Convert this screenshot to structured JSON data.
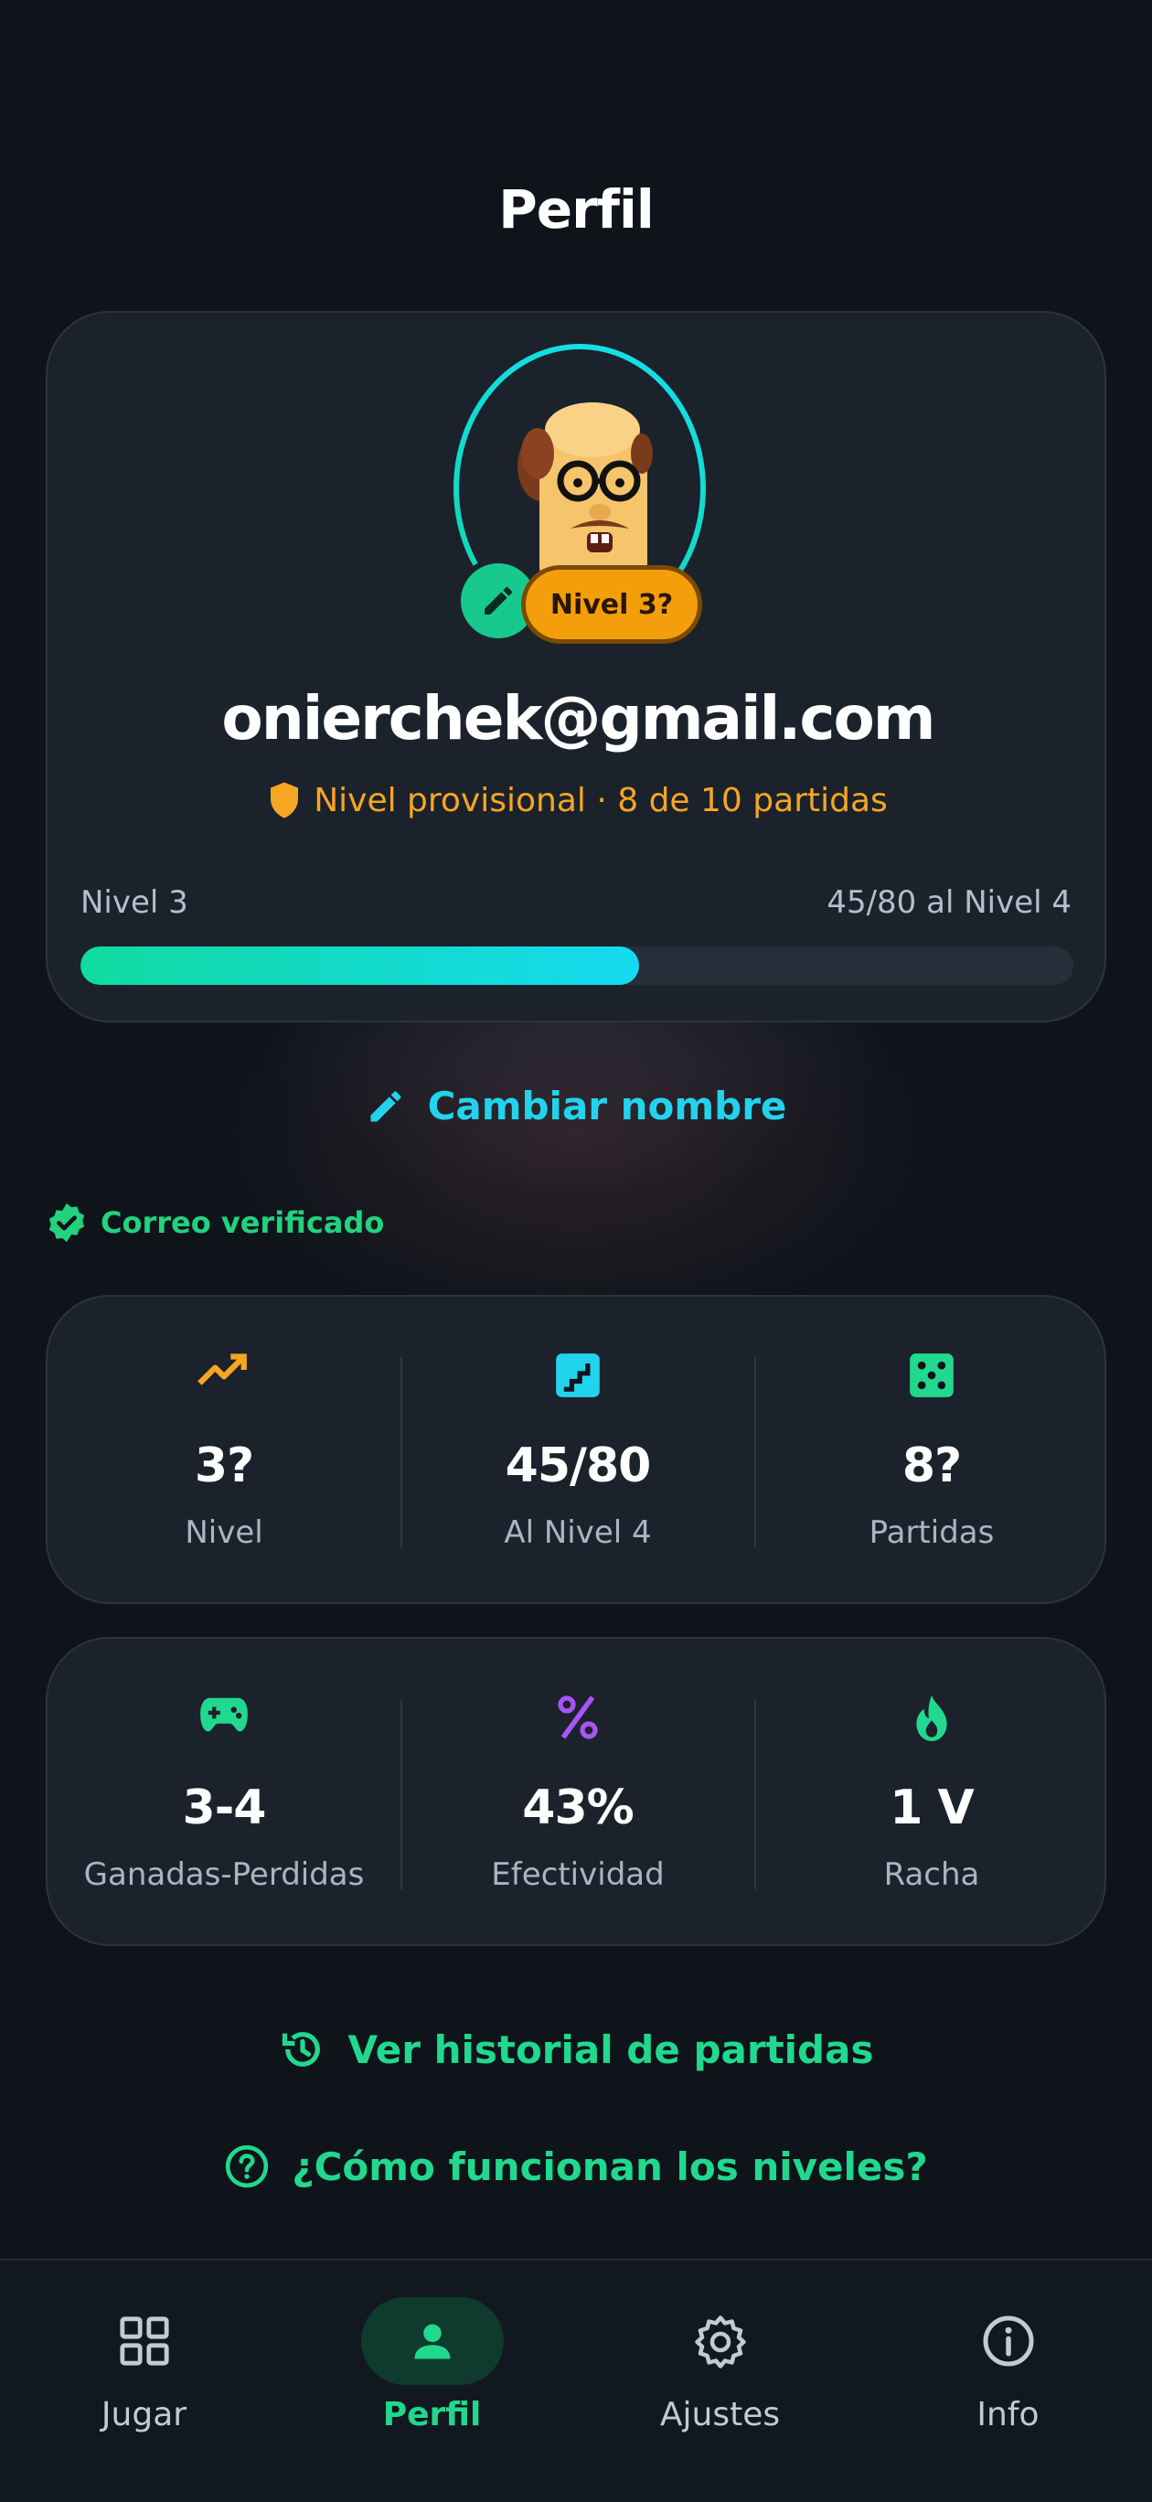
{
  "header": {
    "title": "Perfil"
  },
  "profile": {
    "level_badge": "Nivel 3?",
    "email": "onierchek@gmail.com",
    "provisional_text": "Nivel provisional · 8 de 10 partidas",
    "progress_left_label": "Nivel 3",
    "progress_right_label": "45/80 al Nivel 4",
    "progress_fraction": 0.5625
  },
  "actions": {
    "rename": "Cambiar nombre",
    "verified": "Correo verificado",
    "history": "Ver historial de partidas",
    "howto": "¿Cómo funcionan los niveles?"
  },
  "stats_row1": [
    {
      "icon": "trending-up-icon",
      "value": "3?",
      "label": "Nivel",
      "color": "#f5a623"
    },
    {
      "icon": "stairs-icon",
      "value": "45/80",
      "label": "Al Nivel 4",
      "color": "#22d3ee"
    },
    {
      "icon": "dice-icon",
      "value": "8?",
      "label": "Partidas",
      "color": "#20d98e"
    }
  ],
  "stats_row2": [
    {
      "icon": "gamepad-icon",
      "value": "3-4",
      "label": "Ganadas-Perdidas",
      "color": "#20d98e"
    },
    {
      "icon": "percent-icon",
      "value": "43%",
      "label": "Efectividad",
      "color": "#a855f7"
    },
    {
      "icon": "flame-icon",
      "value": "1 V",
      "label": "Racha",
      "color": "#20d98e"
    }
  ],
  "nav": [
    {
      "icon": "grid-icon",
      "label": "Jugar",
      "active": false
    },
    {
      "icon": "person-icon",
      "label": "Perfil",
      "active": true
    },
    {
      "icon": "gear-icon",
      "label": "Ajustes",
      "active": false
    },
    {
      "icon": "info-icon",
      "label": "Info",
      "active": false
    }
  ],
  "colors": {
    "accent_green": "#20d98e",
    "accent_cyan": "#22d3ee",
    "accent_orange": "#f5a623",
    "background": "#0f141b",
    "card": "#1b222c"
  }
}
